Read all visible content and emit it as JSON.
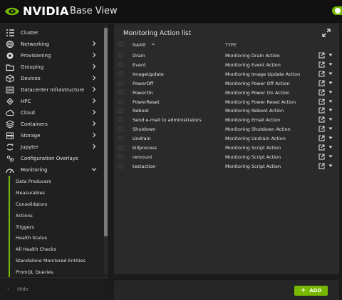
{
  "header": {
    "brand": "NVIDIA",
    "product": "Base View"
  },
  "sidebar": {
    "items": [
      {
        "label": "Cluster",
        "icon": "list-icon",
        "chevron": "none"
      },
      {
        "label": "Networking",
        "icon": "network-icon",
        "chevron": "right"
      },
      {
        "label": "Provisioning",
        "icon": "provisioning-icon",
        "chevron": "right"
      },
      {
        "label": "Grouping",
        "icon": "folder-icon",
        "chevron": "right"
      },
      {
        "label": "Devices",
        "icon": "cube-icon",
        "chevron": "right"
      },
      {
        "label": "Datacenter Infrastructure",
        "icon": "datacenter-icon",
        "chevron": "right"
      },
      {
        "label": "HPC",
        "icon": "hpc-icon",
        "chevron": "right"
      },
      {
        "label": "Cloud",
        "icon": "cloud-icon",
        "chevron": "right"
      },
      {
        "label": "Containers",
        "icon": "containers-icon",
        "chevron": "right"
      },
      {
        "label": "Storage",
        "icon": "storage-icon",
        "chevron": "right"
      },
      {
        "label": "Jupyter",
        "icon": "jupyter-icon",
        "chevron": "right"
      },
      {
        "label": "Configuration Overlays",
        "icon": "overlays-icon",
        "chevron": "none"
      },
      {
        "label": "Monitoring",
        "icon": "monitoring-icon",
        "chevron": "down"
      }
    ],
    "sub_items": [
      "Data Producers",
      "Measurables",
      "Consolidators",
      "Actions",
      "Triggers",
      "Health Status",
      "All Health Checks",
      "Standalone Monitored Entities",
      "PromQL Queries"
    ],
    "hide_label": "Hide"
  },
  "panel": {
    "title": "Monitoring Action list",
    "columns": {
      "name": "NAME",
      "type": "TYPE"
    },
    "rows": [
      {
        "name": "Drain",
        "type": "Monitoring Drain Action"
      },
      {
        "name": "Event",
        "type": "Monitoring Event Action"
      },
      {
        "name": "ImageUpdate",
        "type": "Monitoring Image Update Action"
      },
      {
        "name": "PowerOff",
        "type": "Monitoring Power Off Action"
      },
      {
        "name": "PowerOn",
        "type": "Monitoring Power On Action"
      },
      {
        "name": "PowerReset",
        "type": "Monitoring Power Reset Action"
      },
      {
        "name": "Reboot",
        "type": "Monitoring Reboot Action"
      },
      {
        "name": "Send e-mail to administrators",
        "type": "Monitoring Email Action"
      },
      {
        "name": "Shutdown",
        "type": "Monitoring Shutdown Action"
      },
      {
        "name": "Undrain",
        "type": "Monitoring Undrain Action"
      },
      {
        "name": "killprocess",
        "type": "Monitoring Script Action"
      },
      {
        "name": "remount",
        "type": "Monitoring Script Action"
      },
      {
        "name": "testaction",
        "type": "Monitoring Script Action"
      }
    ]
  },
  "footer": {
    "add_label": "ADD"
  },
  "colors": {
    "accent": "#76b900",
    "background": "#1b1b1b",
    "panel": "#2a2a2a"
  }
}
